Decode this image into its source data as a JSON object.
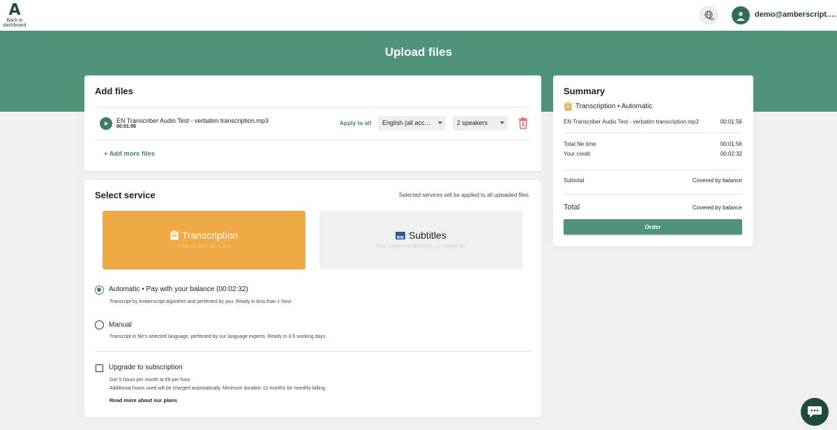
{
  "header": {
    "logo_mark": "A",
    "back_label_line1": "Back to",
    "back_label_line2": "dashboard",
    "language_code": "en",
    "user_email": "demo@amberscript.com"
  },
  "page_title": "Upload files",
  "add_files": {
    "title": "Add files",
    "files": [
      {
        "name": "EN Transcriber Audio Test - verbatim transcription.mp3",
        "duration": "00:01:56",
        "language": "English (all accents)",
        "speakers": "2 speakers"
      }
    ],
    "apply_to_all": "Apply to all",
    "add_more": "+ Add more files"
  },
  "select_service": {
    "title": "Select service",
    "note": "Selected services will be applied to all uploaded files.",
    "tiles": [
      {
        "label": "Transcription",
        "sub": "Audio or video file to text",
        "selected": true
      },
      {
        "label": "Subtitles",
        "sub": "Time-coded text delivered in a subtitle file",
        "selected": false
      }
    ],
    "options": [
      {
        "title": "Automatic • Pay with your balance (00:02:32)",
        "desc": "Transcript by Amberscript algorithm and perfected by you. Ready in less than 1 hour.",
        "selected": true
      },
      {
        "title": "Manual",
        "desc": "Transcript in file's selected language, perfected by our language experts. Ready in 3-5 working days.",
        "selected": false
      }
    ],
    "upgrade": {
      "title": "Upgrade to subscription",
      "line1": "Get 5 hours per month at €8 per hour.",
      "line2": "Additional hours used will be charged automatically. Minimum duration 12 months for monthly billing.",
      "link": "Read more about our plans",
      "checked": false
    }
  },
  "summary": {
    "title": "Summary",
    "service": "Transcription • Automatic",
    "file_name": "EN Transcriber Audio Test - verbatim transcription.mp3",
    "file_duration": "00:01:56",
    "total_file_time_label": "Total file time",
    "total_file_time": "00:01:56",
    "credit_label": "Your credit",
    "credit": "00:02:32",
    "subtotal_label": "Subtotal",
    "subtotal": "Covered by balance",
    "total_label": "Total",
    "total": "Covered by balance",
    "order_label": "Order"
  },
  "colors": {
    "brand_green": "#4e9478",
    "dark_green": "#1f4b3b",
    "accent_orange": "#f0aa45",
    "danger_red": "#e05555"
  }
}
